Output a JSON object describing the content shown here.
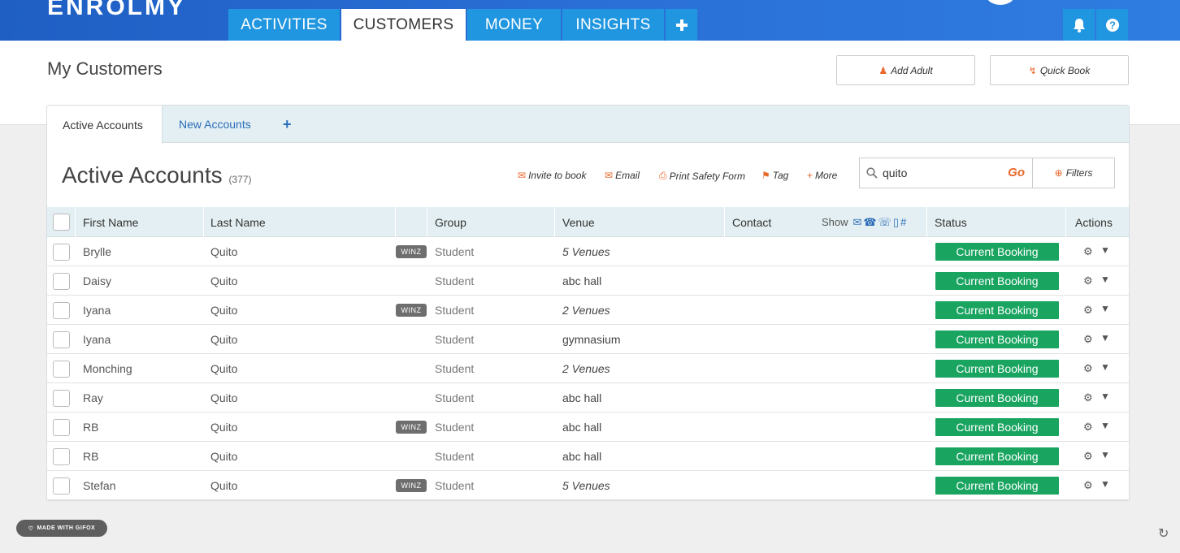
{
  "app": {
    "logo_text": "ENROLMY",
    "nav": [
      {
        "label": "ACTIVITIES"
      },
      {
        "label": "CUSTOMERS"
      },
      {
        "label": "MONEY"
      },
      {
        "label": "INSIGHTS"
      }
    ],
    "nav_add_icon": "plus-icon",
    "bell_icon": "bell-icon",
    "help_icon": "question-icon",
    "colors": {
      "nav_blue": "#2196e0",
      "brand_dark": "#1f5fc4",
      "accent_orange": "#e8672a",
      "status_green": "#19a460",
      "link_blue": "#2a6db8"
    }
  },
  "header": {
    "title": "My Customers",
    "add_adult_label": "Add Adult",
    "quick_book_label": "Quick Book"
  },
  "tabs": {
    "active_label": "Active Accounts",
    "new_label": "New Accounts",
    "add_symbol": "+"
  },
  "accounts": {
    "title": "Active Accounts",
    "count": "(377)"
  },
  "toolbar": {
    "invite_label": "Invite to book",
    "email_label": "Email",
    "print_label": "Print Safety Form",
    "tag_label": "Tag",
    "more_label": "More"
  },
  "search": {
    "value": "quito",
    "go_label": "Go",
    "filters_label": "Filters"
  },
  "table": {
    "headers": {
      "first_name": "First Name",
      "last_name": "Last Name",
      "group": "Group",
      "venue": "Venue",
      "contact": "Contact",
      "show": "Show",
      "status": "Status",
      "actions": "Actions"
    },
    "rows": [
      {
        "first": "Brylle",
        "last": "Quito",
        "winz": "WINZ",
        "group": "Student",
        "venue": "5 Venues",
        "status": "Current Booking"
      },
      {
        "first": "Daisy",
        "last": "Quito",
        "winz": "",
        "group": "Student",
        "venue": "abc hall",
        "status": "Current Booking"
      },
      {
        "first": "Iyana",
        "last": "Quito",
        "winz": "WINZ",
        "group": "Student",
        "venue": "2 Venues",
        "status": "Current Booking"
      },
      {
        "first": "Iyana",
        "last": "Quito",
        "winz": "",
        "group": "Student",
        "venue": "gymnasium",
        "status": "Current Booking"
      },
      {
        "first": "Monching",
        "last": "Quito",
        "winz": "",
        "group": "Student",
        "venue": "2 Venues",
        "status": "Current Booking"
      },
      {
        "first": "Ray",
        "last": "Quito",
        "winz": "",
        "group": "Student",
        "venue": "abc hall",
        "status": "Current Booking"
      },
      {
        "first": "RB",
        "last": "Quito",
        "winz": "WINZ",
        "group": "Student",
        "venue": "abc hall",
        "status": "Current Booking"
      },
      {
        "first": "RB",
        "last": "Quito",
        "winz": "",
        "group": "Student",
        "venue": "abc hall",
        "status": "Current Booking"
      },
      {
        "first": "Stefan",
        "last": "Quito",
        "winz": "WINZ",
        "group": "Student",
        "venue": "5 Venues",
        "status": "Current Booking"
      }
    ]
  },
  "watermark": {
    "label": "MADE WITH GIFOX"
  }
}
